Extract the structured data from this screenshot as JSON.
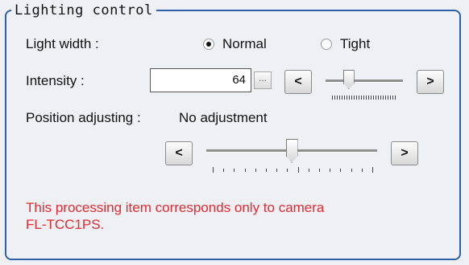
{
  "group_title": "Lighting control",
  "light_width": {
    "label": "Light width :",
    "options": [
      {
        "label": "Normal",
        "checked": true
      },
      {
        "label": "Tight",
        "checked": false
      }
    ]
  },
  "intensity": {
    "label": "Intensity :",
    "value": "64",
    "ellipsis_label": "...",
    "decrease_label": "<",
    "increase_label": ">",
    "slider_level": 0.3
  },
  "position": {
    "label": "Position adjusting :",
    "value": "No adjustment",
    "decrease_label": "<",
    "increase_label": ">",
    "slider_level": 0.5,
    "tick_count": 16
  },
  "warning": "This processing item corresponds only to camera\nFL-TCC1PS.",
  "colors": {
    "border": "#2f5fa6",
    "warning_text": "#e8282f",
    "background": "#eef0f4"
  }
}
